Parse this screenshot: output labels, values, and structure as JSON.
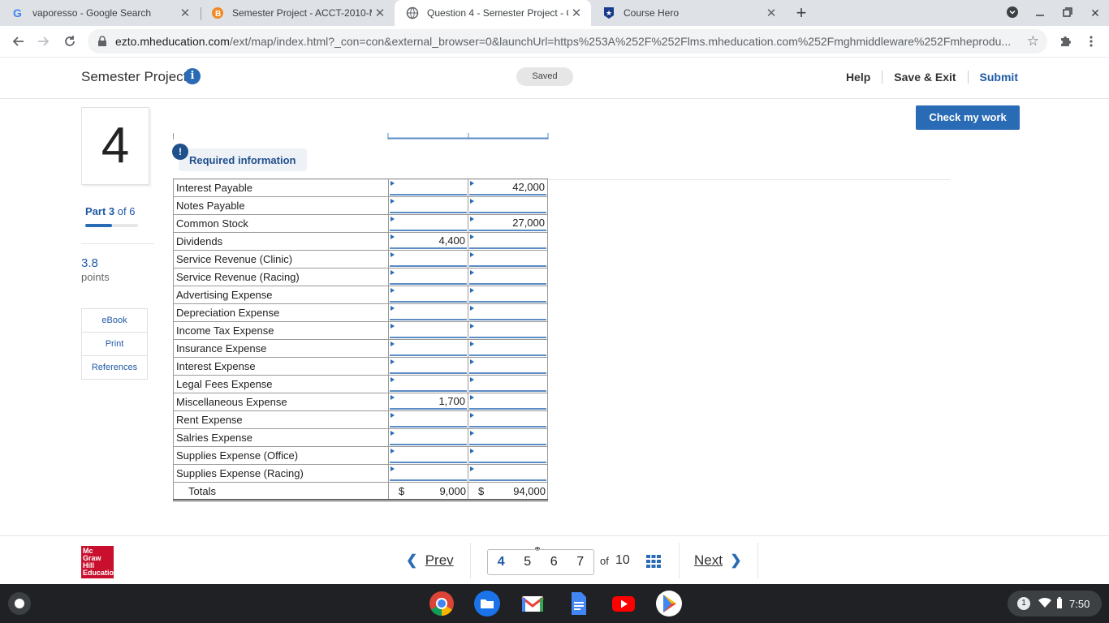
{
  "browser": {
    "tabs": [
      {
        "title": "vaporesso - Google Search",
        "icon": "google-icon",
        "active": false
      },
      {
        "title": "Semester Project - ACCT-2010-M",
        "icon": "blackboard-icon",
        "active": false
      },
      {
        "title": "Question 4 - Semester Project - C",
        "icon": "globe-icon",
        "active": true
      },
      {
        "title": "Course Hero",
        "icon": "coursehero-icon",
        "active": false
      }
    ],
    "url_domain": "ezto.mheducation.com",
    "url_path": "/ext/map/index.html?_con=con&external_browser=0&launchUrl=https%253A%252F%252Flms.mheducation.com%252Fmghmiddleware%252Fmheprodu..."
  },
  "header": {
    "title": "Semester Project",
    "status": "Saved",
    "help": "Help",
    "save_exit": "Save & Exit",
    "submit": "Submit"
  },
  "sidebar": {
    "question_number": "4",
    "part_label": "Part 3",
    "part_of": "of 6",
    "progress_fraction": 0.5,
    "points_value": "3.8",
    "points_label": "points",
    "tools": [
      "eBook",
      "Print",
      "References"
    ]
  },
  "main": {
    "check_button": "Check my work",
    "required_info": "Required information",
    "required_badge": "!",
    "rows": [
      {
        "account": "Interest Payable",
        "debit": "",
        "credit": "42,000"
      },
      {
        "account": "Notes Payable",
        "debit": "",
        "credit": ""
      },
      {
        "account": "Common Stock",
        "debit": "",
        "credit": "27,000"
      },
      {
        "account": "Dividends",
        "debit": "4,400",
        "credit": ""
      },
      {
        "account": "Service Revenue (Clinic)",
        "debit": "",
        "credit": ""
      },
      {
        "account": "Service Revenue (Racing)",
        "debit": "",
        "credit": ""
      },
      {
        "account": "Advertising Expense",
        "debit": "",
        "credit": ""
      },
      {
        "account": "Depreciation Expense",
        "debit": "",
        "credit": ""
      },
      {
        "account": "Income Tax Expense",
        "debit": "",
        "credit": ""
      },
      {
        "account": "Insurance Expense",
        "debit": "",
        "credit": ""
      },
      {
        "account": "Interest Expense",
        "debit": "",
        "credit": ""
      },
      {
        "account": "Legal Fees Expense",
        "debit": "",
        "credit": ""
      },
      {
        "account": "Miscellaneous Expense",
        "debit": "1,700",
        "credit": ""
      },
      {
        "account": "Rent Expense",
        "debit": "",
        "credit": ""
      },
      {
        "account": "Salries Expense",
        "debit": "",
        "credit": ""
      },
      {
        "account": "Supplies Expense (Office)",
        "debit": "",
        "credit": ""
      },
      {
        "account": "Supplies Expense (Racing)",
        "debit": "",
        "credit": ""
      }
    ],
    "totals": {
      "label": "Totals",
      "currency": "$",
      "debit": "9,000",
      "credit": "94,000"
    }
  },
  "footer": {
    "logo_text": "Mc Graw Hill Education",
    "prev": "Prev",
    "pages": [
      "4",
      "5",
      "6",
      "7"
    ],
    "current_page": "4",
    "of_label": "of",
    "total_pages": "10",
    "next": "Next"
  },
  "shelf": {
    "notification_count": "1",
    "time": "7:50",
    "apps": [
      "chrome-icon",
      "files-icon",
      "gmail-icon",
      "docs-icon",
      "youtube-icon",
      "play-store-icon"
    ]
  }
}
